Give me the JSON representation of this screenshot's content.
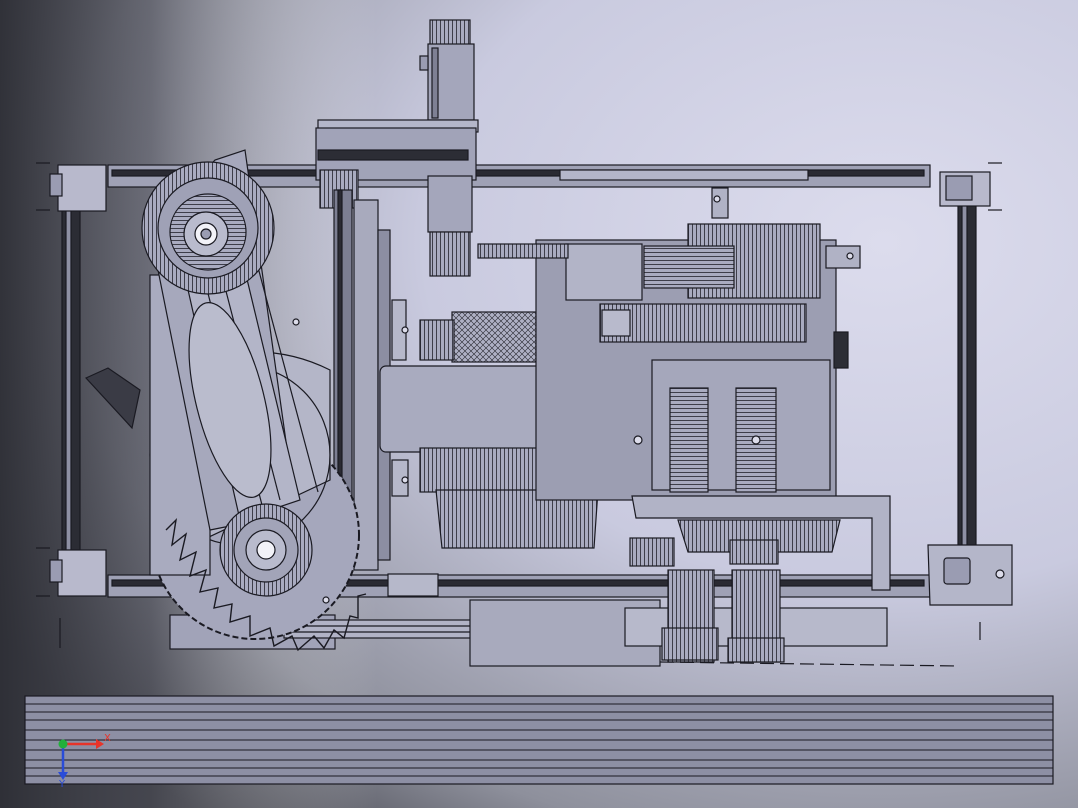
{
  "viewport": {
    "background_light": "#d2d3e8",
    "background_dark": "#4a4c56",
    "model_face": "#9a9cb2",
    "model_edge": "#1a1a22"
  },
  "triad": {
    "x_label": "X",
    "y_label": "Y",
    "x_color": "#e8342a",
    "y_color": "#2a4cd8",
    "z_color": "#22b03a"
  }
}
